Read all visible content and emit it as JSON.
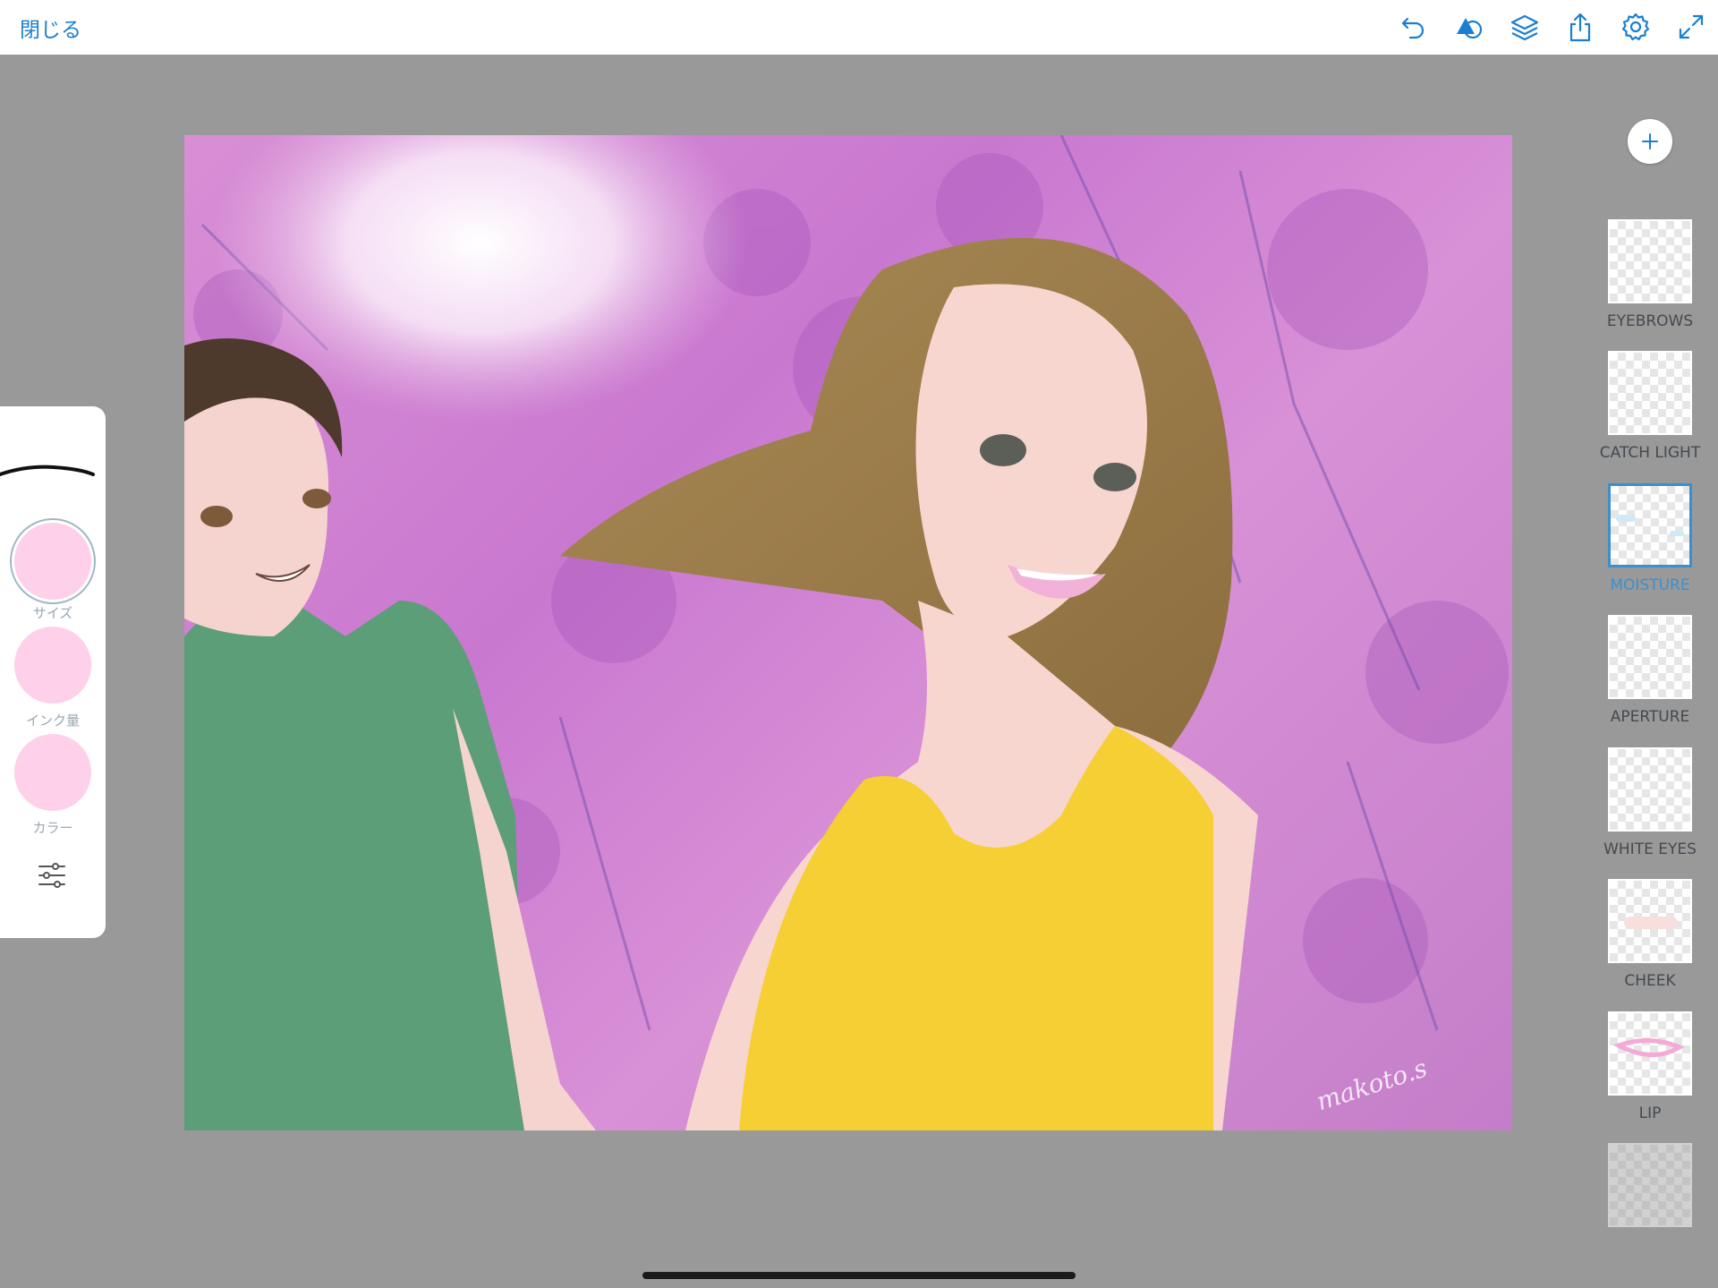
{
  "topbar": {
    "close_label": "閉じる",
    "icons": [
      "undo-icon",
      "shape-icon",
      "layers-icon",
      "share-icon",
      "settings-icon",
      "fullscreen-icon"
    ],
    "accent": "#1a7fd0"
  },
  "brush_panel": {
    "size_label": "サイズ",
    "ink_label": "インク量",
    "color_label": "カラー",
    "swatch_color": "#ffd0ea"
  },
  "canvas": {
    "signature": "makoto.s"
  },
  "layers": {
    "add_icon": "plus-icon",
    "selected_color": "#3b8fcf",
    "items": [
      {
        "label": "EYEBROWS"
      },
      {
        "label": "CATCH LIGHT"
      },
      {
        "label": "MOISTURE"
      },
      {
        "label": "APERTURE"
      },
      {
        "label": "WHITE EYES"
      },
      {
        "label": "CHEEK"
      },
      {
        "label": "LIP"
      }
    ]
  }
}
